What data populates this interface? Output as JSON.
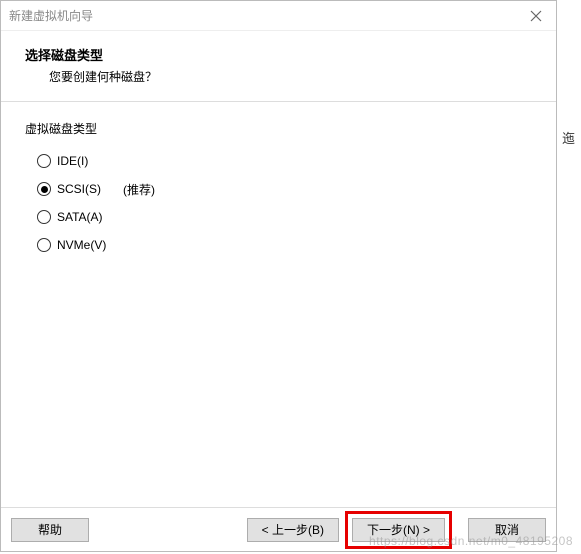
{
  "titlebar": {
    "title": "新建虚拟机向导"
  },
  "header": {
    "title": "选择磁盘类型",
    "subtitle": "您要创建何种磁盘？"
  },
  "group": {
    "label": "虚拟磁盘类型",
    "options": {
      "ide": "IDE(I)",
      "scsi": "SCSI(S)",
      "scsi_hint": "(推荐)",
      "sata": "SATA(A)",
      "nvme": "NVMe(V)"
    }
  },
  "footer": {
    "help": "帮助",
    "back": "< 上一步(B)",
    "next": "下一步(N) >",
    "cancel": "取消"
  },
  "side": {
    "text": "迤"
  },
  "watermark": "https://blog.csdn.net/m0_48195208"
}
